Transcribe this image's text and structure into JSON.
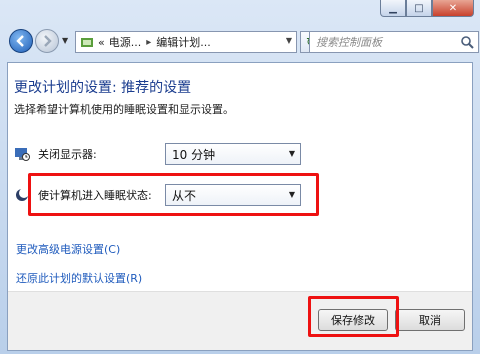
{
  "window": {
    "minimize_icon": "minimize-icon",
    "maximize_icon": "maximize-icon",
    "close_icon": "close-icon"
  },
  "nav": {
    "breadcrumb": {
      "prefix": "«",
      "items": [
        "电源...",
        "编辑计划..."
      ]
    },
    "search_placeholder": "搜索控制面板"
  },
  "page": {
    "title": "更改计划的设置: 推荐的设置",
    "subtitle": "选择希望计算机使用的睡眠设置和显示设置。"
  },
  "settings": {
    "display_off": {
      "label": "关闭显示器:",
      "value": "10 分钟"
    },
    "sleep": {
      "label": "使计算机进入睡眠状态:",
      "value": "从不"
    }
  },
  "links": {
    "advanced": "更改高级电源设置(C)",
    "restore": "还原此计划的默认设置(R)"
  },
  "buttons": {
    "save": "保存修改",
    "cancel": "取消"
  },
  "colors": {
    "highlight": "#ee1111",
    "title": "#1b3d8f",
    "link": "#1f5bbd"
  }
}
